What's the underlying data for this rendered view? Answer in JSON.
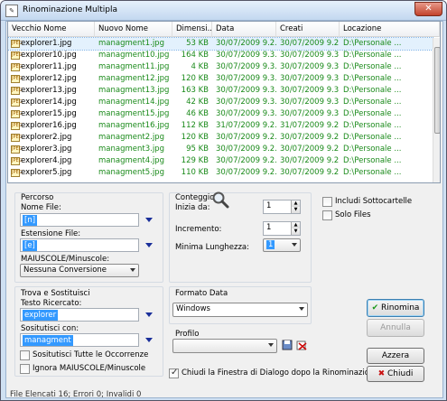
{
  "window": {
    "title": "Rinominazione Multipla",
    "close_glyph": "✕",
    "app_icon": "rename-app-icon"
  },
  "list": {
    "columns": [
      "Vecchio Nome",
      "Nuovo Nome",
      "Dimensi...",
      "Data",
      "Creati",
      "Locazione"
    ],
    "file_icon_text": "JPEG",
    "rows": [
      {
        "old": "explorer1.jpg",
        "new": "managment1.jpg",
        "size": "53 KB",
        "date": "30/07/2009 9.2...",
        "created": "30/07/2009 9.2...",
        "loc": "D:\\Personale ..."
      },
      {
        "old": "explorer10.jpg",
        "new": "managment10.jpg",
        "size": "164 KB",
        "date": "30/07/2009 9.3...",
        "created": "30/07/2009 9.3...",
        "loc": "D:\\Personale ..."
      },
      {
        "old": "explorer11.jpg",
        "new": "managment11.jpg",
        "size": "4 KB",
        "date": "30/07/2009 9.3...",
        "created": "30/07/2009 9.3...",
        "loc": "D:\\Personale ..."
      },
      {
        "old": "explorer12.jpg",
        "new": "managment12.jpg",
        "size": "120 KB",
        "date": "30/07/2009 9.3...",
        "created": "30/07/2009 9.3...",
        "loc": "D:\\Personale ..."
      },
      {
        "old": "explorer13.jpg",
        "new": "managment13.jpg",
        "size": "163 KB",
        "date": "30/07/2009 9.3...",
        "created": "30/07/2009 9.3...",
        "loc": "D:\\Personale ..."
      },
      {
        "old": "explorer14.jpg",
        "new": "managment14.jpg",
        "size": "42 KB",
        "date": "30/07/2009 9.3...",
        "created": "30/07/2009 9.3...",
        "loc": "D:\\Personale ..."
      },
      {
        "old": "explorer15.jpg",
        "new": "managment15.jpg",
        "size": "46 KB",
        "date": "30/07/2009 9.3...",
        "created": "30/07/2009 9.3...",
        "loc": "D:\\Personale ..."
      },
      {
        "old": "explorer16.jpg",
        "new": "managment16.jpg",
        "size": "112 KB",
        "date": "31/07/2009 9.2...",
        "created": "31/07/2009 9.2...",
        "loc": "D:\\Personale ..."
      },
      {
        "old": "explorer2.jpg",
        "new": "managment2.jpg",
        "size": "120 KB",
        "date": "30/07/2009 9.2...",
        "created": "30/07/2009 9.2...",
        "loc": "D:\\Personale ..."
      },
      {
        "old": "explorer3.jpg",
        "new": "managment3.jpg",
        "size": "95 KB",
        "date": "30/07/2009 9.2...",
        "created": "30/07/2009 9.2...",
        "loc": "D:\\Personale ..."
      },
      {
        "old": "explorer4.jpg",
        "new": "managment4.jpg",
        "size": "129 KB",
        "date": "30/07/2009 9.2...",
        "created": "30/07/2009 9.2...",
        "loc": "D:\\Personale ..."
      },
      {
        "old": "explorer5.jpg",
        "new": "managment5.jpg",
        "size": "110 KB",
        "date": "30/07/2009 9.2...",
        "created": "30/07/2009 9.2...",
        "loc": "D:\\Personale ..."
      }
    ]
  },
  "percorso": {
    "title": "Percorso",
    "nome_label": "Nome File:",
    "nome_value": "[n]",
    "estensione_label": "Estensione File:",
    "estensione_value": "[e]",
    "case_label": "MAIUSCOLE/Minuscole:",
    "case_value": "Nessuna Conversione"
  },
  "conteggio": {
    "title": "Conteggio",
    "icon": "magnifier-icon",
    "inizia_label": "Inizia da:",
    "inizia_value": "1",
    "incremento_label": "Incremento:",
    "incremento_value": "1",
    "minima_label": "Minima Lunghezza:",
    "minima_value": "1"
  },
  "options": {
    "sottocartelle": "Includi Sottocartelle",
    "solo_files": "Solo Files"
  },
  "trova": {
    "title": "Trova e Sostituisci",
    "testo_label": "Testo Ricercato:",
    "testo_value": "explorer",
    "sostituisci_label": "Sositutisci con:",
    "sostituisci_value": "managment",
    "tutte_label": "Sositutisci Tutte le Occorrenze",
    "ignora_label": "Ignora MAIUSCOLE/Minuscole"
  },
  "formato": {
    "title": "Formato Data",
    "value": "Windows"
  },
  "profilo": {
    "title": "Profilo",
    "value": ""
  },
  "chiudi_checkbox": "Chiudi la Finestra di Dialogo dopo la Rinominazio",
  "buttons": {
    "rinomina": "Rinomina",
    "annulla": "Annulla",
    "azzera": "Azzera",
    "chiudi": "Chiudi"
  },
  "status": "File Elencati 16; Errori 0; Invalidi 0"
}
